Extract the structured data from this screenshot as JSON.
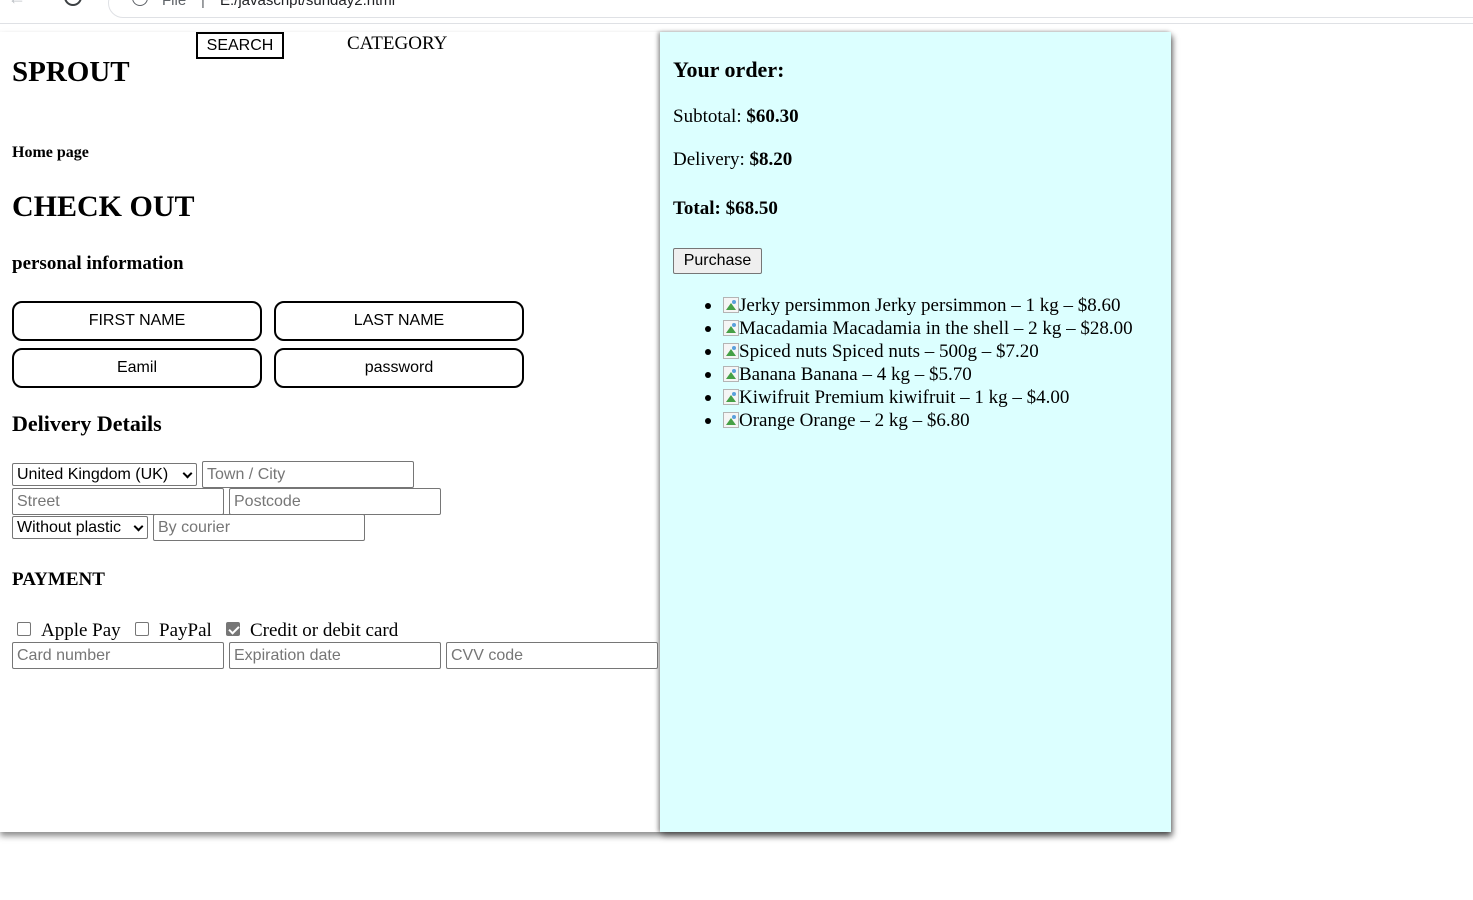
{
  "browser": {
    "scheme_label": "File",
    "separator": "|",
    "url": "E:/javascript/sunday2.html"
  },
  "header": {
    "logo": "SPROUT",
    "search_label": "SEARCH",
    "category_label": "CATEGORY",
    "home_link": "Home page"
  },
  "checkout": {
    "title": "CHECK OUT",
    "personal_heading": "personal information",
    "first_name": "FIRST NAME",
    "last_name": "LAST NAME",
    "email": "Eamil",
    "password": "password",
    "delivery_heading": "Delivery Details",
    "country": "United Kingdom (UK)",
    "town_placeholder": "Town / City",
    "street_placeholder": "Street",
    "postcode_placeholder": "Postcode",
    "packaging": "Without plastic",
    "courier_placeholder": "By courier",
    "payment_heading": "PAYMENT",
    "payment_options": [
      {
        "label": "Apple Pay",
        "checked": false
      },
      {
        "label": "PayPal",
        "checked": false
      },
      {
        "label": "Credit or debit card",
        "checked": true
      }
    ],
    "card_placeholder": "Card number",
    "expiration_placeholder": "Expiration date",
    "cvv_placeholder": "CVV code"
  },
  "order": {
    "title": "Your order:",
    "subtotal_label": "Subtotal:",
    "subtotal_value": "$60.30",
    "delivery_label": "Delivery:",
    "delivery_value": "$8.20",
    "total_label": "Total:",
    "total_value": "$68.50",
    "purchase_label": "Purchase",
    "items": [
      {
        "alt": "Jerky persimmon",
        "text": " Jerky persimmon – 1 kg – $8.60"
      },
      {
        "alt": "Macadamia",
        "text": " Macadamia in the shell – 2 kg – $28.00"
      },
      {
        "alt": "Spiced nuts",
        "text": " Spiced nuts – 500g – $7.20"
      },
      {
        "alt": "Banana",
        "text": " Banana – 4 kg – $5.70"
      },
      {
        "alt": "Kiwifruit",
        "text": " Premium kiwifruit – 1 kg – $4.00"
      },
      {
        "alt": "Orange",
        "text": " Orange – 2 kg – $6.80"
      }
    ],
    "panel_color": "#dcffff"
  }
}
